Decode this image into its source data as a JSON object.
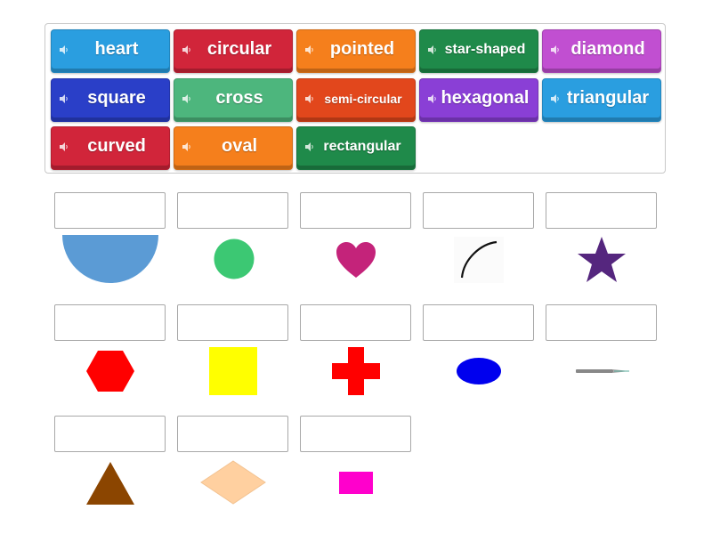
{
  "word_bank": {
    "tiles": [
      {
        "label": "heart",
        "color": "#2a9ee0"
      },
      {
        "label": "circular",
        "color": "#d1253a"
      },
      {
        "label": "pointed",
        "color": "#f57f1c"
      },
      {
        "label": "star-shaped",
        "color": "#1f8a4a"
      },
      {
        "label": "diamond",
        "color": "#c14fd1"
      },
      {
        "label": "square",
        "color": "#2a3fc8"
      },
      {
        "label": "cross",
        "color": "#4db67d"
      },
      {
        "label": "semi-circular",
        "color": "#e2471c"
      },
      {
        "label": "hexagonal",
        "color": "#8a3fd6"
      },
      {
        "label": "triangular",
        "color": "#2a9ee0"
      },
      {
        "label": "curved",
        "color": "#d1253a"
      },
      {
        "label": "oval",
        "color": "#f57f1c"
      },
      {
        "label": "rectangular",
        "color": "#1f8a4a"
      }
    ]
  },
  "targets": [
    {
      "shape": "semicircle-icon",
      "color": "#5b9bd5"
    },
    {
      "shape": "circle-icon",
      "color": "#3cc873"
    },
    {
      "shape": "heart-icon",
      "color": "#c4237a"
    },
    {
      "shape": "curve-icon",
      "color": "#111111"
    },
    {
      "shape": "star-icon",
      "color": "#55267e"
    },
    {
      "shape": "hexagon-icon",
      "color": "#ff0000"
    },
    {
      "shape": "square-icon",
      "color": "#ffff00"
    },
    {
      "shape": "cross-icon",
      "color": "#ff0000"
    },
    {
      "shape": "oval-icon",
      "color": "#0000ee"
    },
    {
      "shape": "needle-icon",
      "color": "#777777"
    },
    {
      "shape": "triangle-icon",
      "color": "#8b4500"
    },
    {
      "shape": "diamond-icon",
      "color": "#ffd0a0"
    },
    {
      "shape": "rectangle-icon",
      "color": "#ff00cc"
    }
  ]
}
